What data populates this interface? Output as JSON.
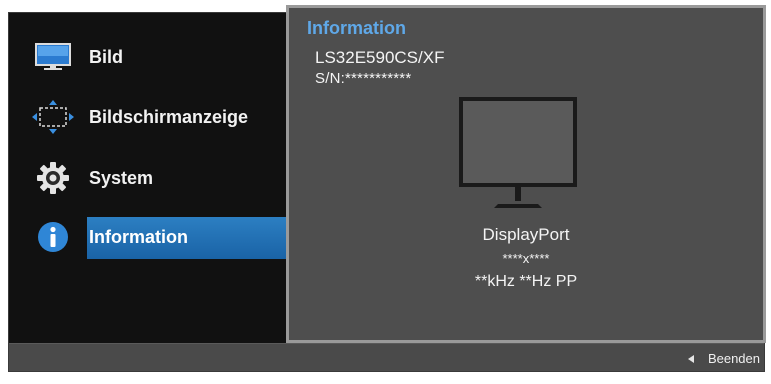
{
  "sidebar": {
    "items": [
      {
        "label": "Bild",
        "icon": "monitor-icon",
        "selected": false
      },
      {
        "label": "Bildschirmanzeige",
        "icon": "screen-position-icon",
        "selected": false
      },
      {
        "label": "System",
        "icon": "gear-icon",
        "selected": false
      },
      {
        "label": "Information",
        "icon": "info-icon",
        "selected": true
      }
    ]
  },
  "panel": {
    "title": "Information",
    "model": "LS32E590CS/XF",
    "serial": "S/N:***********",
    "input": "DisplayPort",
    "resolution": "****x****",
    "frequency": "**kHz **Hz PP"
  },
  "footer": {
    "exit_label": "Beenden",
    "exit_icon": "left-arrow-icon"
  },
  "colors": {
    "accent": "#1a6fb8",
    "title": "#5fa8e8",
    "panel_bg": "#4e4e4e"
  }
}
